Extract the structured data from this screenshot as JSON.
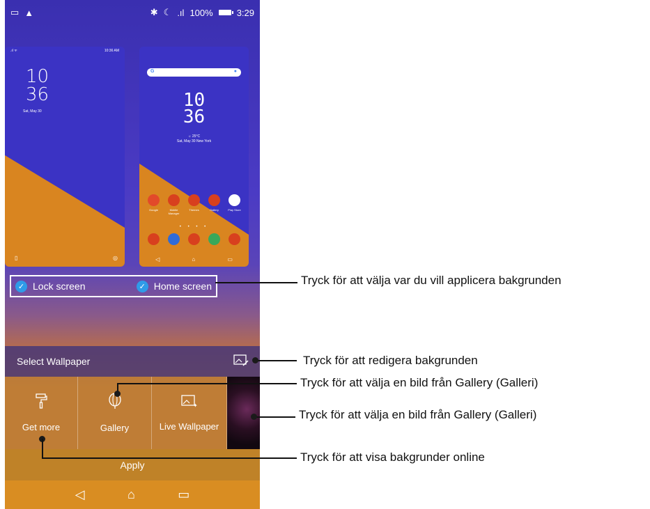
{
  "status_bar": {
    "battery": "100%",
    "time": "3:29"
  },
  "lock_preview": {
    "mini_time": "10:36 AM",
    "clock_hours": "10",
    "clock_minutes": "36",
    "date": "Sat, May 30"
  },
  "home_preview": {
    "clock_hours": "10",
    "clock_minutes": "36",
    "temperature": "25°C",
    "date_location": "Sat, May 30  New York",
    "apps": [
      {
        "label": "Google",
        "color": "#e24a2a"
      },
      {
        "label": "Mobile Manager",
        "color": "#d8401e"
      },
      {
        "label": "Themes",
        "color": "#d8401e"
      },
      {
        "label": "Gallery",
        "color": "#d8401e"
      },
      {
        "label": "Play Store",
        "color": "#ffffff"
      }
    ]
  },
  "targets": {
    "lock_label": "Lock screen",
    "home_label": "Home screen"
  },
  "select_bar": {
    "title": "Select Wallpaper"
  },
  "options": [
    {
      "label": "Get more"
    },
    {
      "label": "Gallery"
    },
    {
      "label": "Live Wallpaper"
    }
  ],
  "apply_label": "Apply",
  "callouts": [
    "Tryck för att välja var du vill applicera bakgrunden",
    "Tryck för att redigera bakgrunden",
    "Tryck för att välja en bild från Gallery (Galleri)",
    "Tryck för att välja en bild från Gallery (Galleri)",
    "Tryck för att visa bakgrunder online"
  ],
  "colors": {
    "accent_check": "#2f9be8",
    "nav_orange": "#d98d22"
  }
}
